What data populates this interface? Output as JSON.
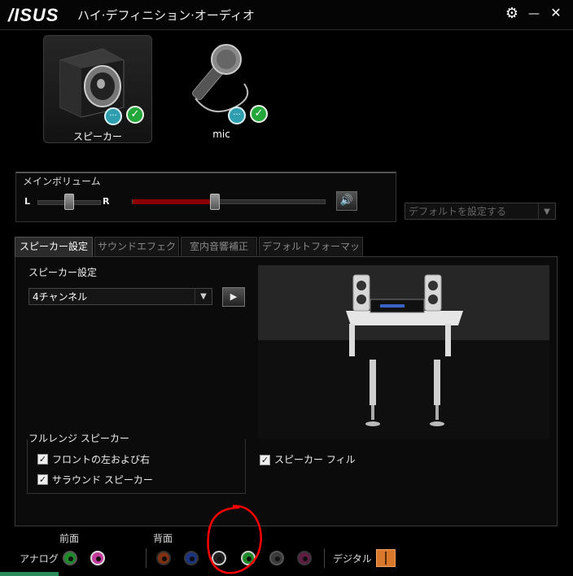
{
  "app": {
    "logo": "/ISUS",
    "title": "ハイ·デフィニション·オーディオ"
  },
  "window_controls": {
    "settings": "⚙",
    "minimize": "—",
    "close": "✕"
  },
  "devices": [
    {
      "label": "スピーカー",
      "selected": true
    },
    {
      "label": "mic",
      "selected": false
    }
  ],
  "volume": {
    "title": "メインボリューム",
    "left": "L",
    "right": "R",
    "balance_fraction": 0.5,
    "level_fraction": 0.43
  },
  "default_device": {
    "label": "デフォルトを設定する"
  },
  "tabs": [
    {
      "label": "スピーカー設定",
      "active": true
    },
    {
      "label": "サウンドエフェクト",
      "active": false
    },
    {
      "label": "室内音響補正",
      "active": false
    },
    {
      "label": "デフォルトフォーマット",
      "active": false
    }
  ],
  "speaker_config": {
    "heading": "スピーカー設定",
    "selected_option": "4チャンネル"
  },
  "fullrange": {
    "title": "フルレンジ スピーカー",
    "front": "フロントの左および右",
    "surround": "サラウンド スピーカー",
    "front_checked": true,
    "surround_checked": true
  },
  "speaker_fill": {
    "label": "スピーカー フィル",
    "checked": true
  },
  "jacks": {
    "front_label": "前面",
    "rear_label": "背面",
    "analog_label": "アナログ",
    "digital_label": "デジタル",
    "front_colors": [
      "#1f8a2a",
      "#c23a9a"
    ],
    "rear_colors": [
      "#b5471a",
      "#2340a0",
      "#222222",
      "#1f8a2a",
      "#3a3a3a",
      "#7a2455"
    ]
  },
  "colors": {
    "accent_red": "#8b0000",
    "annotation": "#ff0000",
    "check_green": "#23a73a"
  }
}
